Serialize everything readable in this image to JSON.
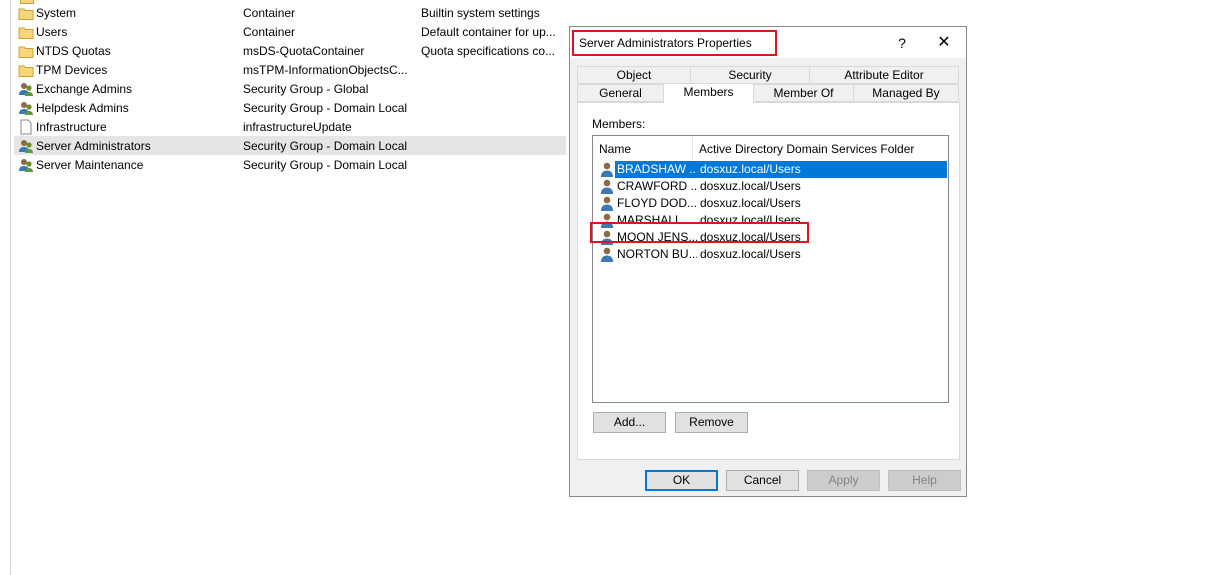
{
  "list": {
    "rows": [
      {
        "name": "System",
        "type": "Container",
        "description": "Builtin system settings",
        "icon": "folder-icon"
      },
      {
        "name": "Users",
        "type": "Container",
        "description": "Default container for up...",
        "icon": "folder-icon"
      },
      {
        "name": "NTDS Quotas",
        "type": "msDS-QuotaContainer",
        "description": "Quota specifications co...",
        "icon": "folder-icon"
      },
      {
        "name": "TPM Devices",
        "type": "msTPM-InformationObjectsC...",
        "description": "",
        "icon": "folder-icon"
      },
      {
        "name": "Exchange Admins",
        "type": "Security Group - Global",
        "description": "",
        "icon": "group-icon"
      },
      {
        "name": "Helpdesk Admins",
        "type": "Security Group - Domain Local",
        "description": "",
        "icon": "group-icon"
      },
      {
        "name": "Infrastructure",
        "type": "infrastructureUpdate",
        "description": "",
        "icon": "document-icon"
      },
      {
        "name": "Server Administrators",
        "type": "Security Group - Domain Local",
        "description": "",
        "icon": "group-icon"
      },
      {
        "name": "Server Maintenance",
        "type": "Security Group - Domain Local",
        "description": "",
        "icon": "group-icon"
      }
    ]
  },
  "dialog": {
    "title": "Server Administrators Properties",
    "help_glyph": "?",
    "close_glyph": "✕",
    "tabs_row1": [
      "Object",
      "Security",
      "Attribute Editor"
    ],
    "tabs_row2": [
      "General",
      "Members",
      "Member Of",
      "Managed By"
    ],
    "active_tab": "Members",
    "members_label": "Members:",
    "columns": [
      "Name",
      "Active Directory Domain Services Folder"
    ],
    "members": [
      {
        "name": "BRADSHAW ...",
        "folder": "dosxuz.local/Users"
      },
      {
        "name": "CRAWFORD ...",
        "folder": "dosxuz.local/Users"
      },
      {
        "name": "FLOYD DOD...",
        "folder": "dosxuz.local/Users"
      },
      {
        "name": "MARSHALL ...",
        "folder": "dosxuz.local/Users"
      },
      {
        "name": "MOON JENS...",
        "folder": "dosxuz.local/Users"
      },
      {
        "name": "NORTON BU...",
        "folder": "dosxuz.local/Users"
      }
    ],
    "add_button": "Add...",
    "remove_button": "Remove",
    "ok_button": "OK",
    "cancel_button": "Cancel",
    "apply_button": "Apply",
    "help_button": "Help"
  },
  "colors": {
    "highlight_box": "#e0141e",
    "selection": "#0078d7"
  }
}
